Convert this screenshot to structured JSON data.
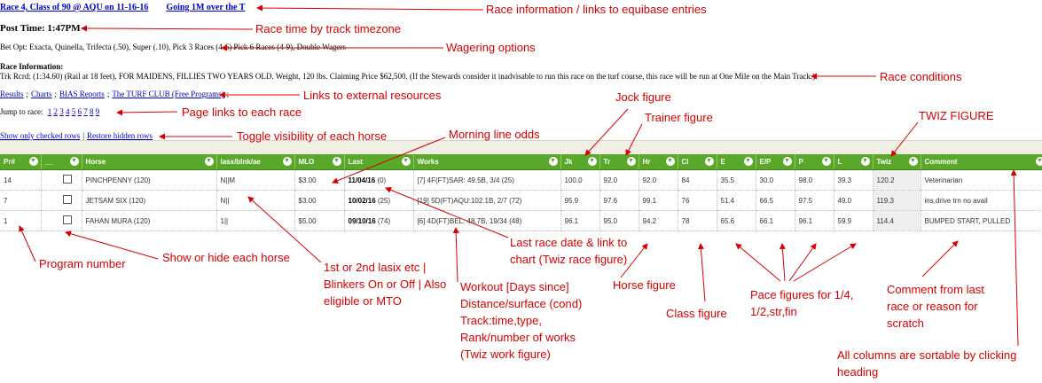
{
  "race": {
    "title_link": "Race 4, Class of 90 @ AQU on 11-16-16",
    "distance_link": "Going 1M over the T",
    "post_time": "Post Time: 1:47PM",
    "bet_options": "Bet Opt: Exacta, Quinella, Trifecta (.50), Super (.10), Pick 3 Races (4-6) Pick 6 Races (4-9), Double Wagers",
    "info_heading": "Race Information:",
    "conditions": "Trk Rcrd: (1:34.60) (Rail at 18 feet). FOR MAIDENS, FILLIES TWO YEARS OLD. Weight, 120 lbs. Claiming Price $62,500. (If the Stewards consider it inadvisable to run this race on the turf course, this race will be run at One Mile on the Main Track.)"
  },
  "links": [
    {
      "label": "Results"
    },
    {
      "label": "Charts"
    },
    {
      "label": "BIAS Reports"
    },
    {
      "label": "The TURF CLUB (Free Programs)"
    }
  ],
  "jump": {
    "label": "Jump to race:",
    "races": [
      "1",
      "2",
      "3",
      "4",
      "5",
      "6",
      "7",
      "8",
      "9"
    ]
  },
  "toggles": {
    "show_checked": "Show only checked rows",
    "restore_hidden": "Restore hidden rows"
  },
  "table": {
    "columns": [
      "Pr#",
      "__",
      "Horse",
      "lasx/blnk/ae",
      "MLO",
      "Last",
      "Works",
      "Jk",
      "Tr",
      "Hr",
      "Cl",
      "E",
      "E/P",
      "P",
      "L",
      "Twiz",
      "Comment"
    ],
    "rows": [
      {
        "pr": "14",
        "horse": "PINCHPENNY (120)",
        "lasix": "N||M",
        "mlo": "$3.00",
        "last_date": "11/04/16",
        "last_fig": "(0)",
        "works": "[7] 4F(FT)SAR: 49.5B, 3/4 (25)",
        "jk": "100.0",
        "tr": "92.0",
        "hr": "92.0",
        "cl": "84",
        "e": "35.5",
        "ep": "30.0",
        "p": "98.0",
        "l": "39.3",
        "twiz": "120.2",
        "comment": "Veterinarian"
      },
      {
        "pr": "7",
        "horse": "JETSAM SIX (120)",
        "lasix": "N||",
        "mlo": "$3.00",
        "last_date": "10/02/16",
        "last_fig": "(25)",
        "works": "[19] 5D(FT)AQU:102.1B, 2/7 (72)",
        "jk": "95.9",
        "tr": "97.6",
        "hr": "99.1",
        "cl": "76",
        "e": "51.4",
        "ep": "66.5",
        "p": "97.5",
        "l": "49.0",
        "twiz": "119.3",
        "comment": "ins,drive trn no avail"
      },
      {
        "pr": "1",
        "horse": "FAHAN MURA (120)",
        "lasix": "1||",
        "mlo": "$5.00",
        "last_date": "09/10/16",
        "last_fig": "(74)",
        "works": "[6] 4D(FT)BEL: 48.7B, 19/34 (48)",
        "jk": "96.1",
        "tr": "95.0",
        "hr": "94.2",
        "cl": "78",
        "e": "65.6",
        "ep": "66.1",
        "p": "96.1",
        "l": "59.9",
        "twiz": "114.4",
        "comment": "BUMPED START, PULLED"
      }
    ]
  },
  "annotations": {
    "race_info": "Race information / links to equibase entries",
    "race_time": "Race time by track timezone",
    "wagering": "Wagering options",
    "conditions": "Race conditions",
    "external": "Links to external resources",
    "page_links": "Page links to each race",
    "toggle": "Toggle visibility of each horse",
    "mlo": "Morning line odds",
    "jock": "Jock figure",
    "trainer": "Trainer figure",
    "twiz": "TWIZ FIGURE",
    "program": "Program number",
    "show_hide": "Show or hide each horse",
    "lasix": "1st or 2nd lasix etc | Blinkers On or Off | Also eligible or MTO",
    "last_race": "Last race date & link to chart (Twiz race figure)",
    "workout": "Workout [Days since] Distance/surface (cond) Track:time,type, Rank/number of works (Twiz work figure)",
    "horse_fig": "Horse figure",
    "class_fig": "Class figure",
    "pace": "Pace figures for 1/4, 1/2,str,fin",
    "comment": "Comment from last race or reason for scratch",
    "sortable": "All columns are sortable by clicking heading"
  },
  "colors": {
    "header_green": "#5aa82a",
    "annotation_red": "#d60000",
    "link_blue": "#0000cc"
  }
}
